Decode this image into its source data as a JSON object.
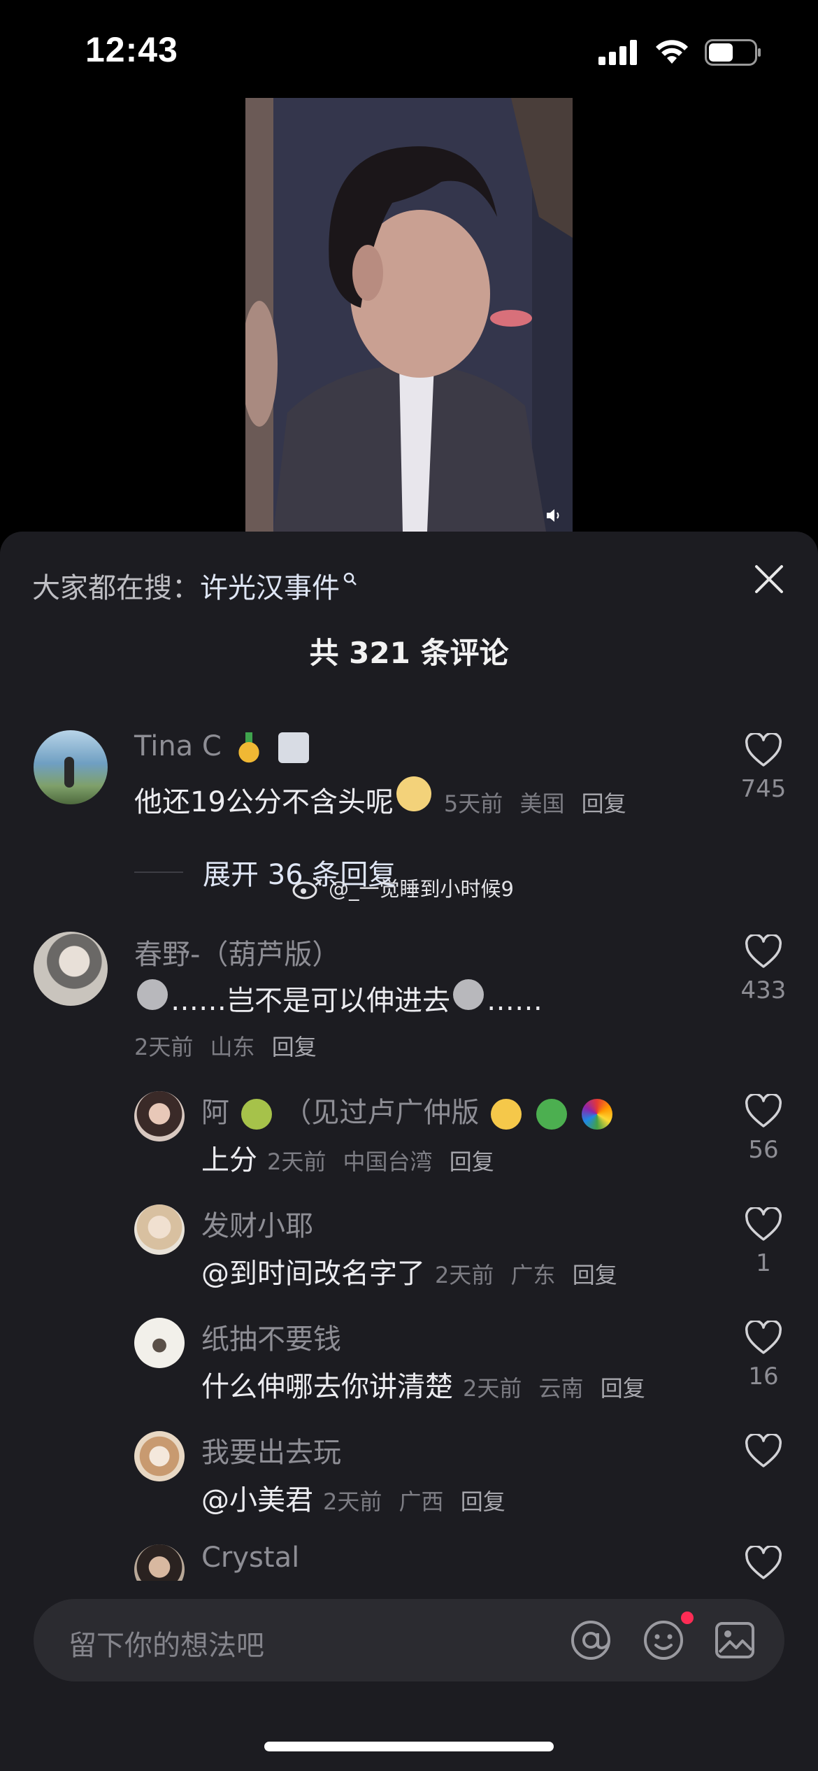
{
  "status_bar": {
    "time": "12:43"
  },
  "sheet": {
    "search_prefix": "大家都在搜：",
    "search_keyword": "许光汉事件",
    "title": "共 321 条评论"
  },
  "comments": [
    {
      "username": "Tina C",
      "text": "他还19公分不含头呢",
      "time": "5天前",
      "location": "美国",
      "reply": "回复",
      "likes": "745"
    },
    {
      "username": "春野-（葫芦版）",
      "text": "……岂不是可以伸进去",
      "text_tail": "……",
      "time": "2天前",
      "location": "山东",
      "reply": "回复",
      "likes": "433"
    }
  ],
  "expand_label": "展开 36 条回复",
  "watermark": "@_一觉睡到小时候9",
  "replies": [
    {
      "username": "阿",
      "username_tail": "（见过卢广仲版",
      "text": "上分",
      "time": "2天前",
      "location": "中国台湾",
      "reply": "回复",
      "likes": "56"
    },
    {
      "username": "发财小耶",
      "text": "@到时间改名字了",
      "time": "2天前",
      "location": "广东",
      "reply": "回复",
      "likes": "1"
    },
    {
      "username": "纸抽不要钱",
      "text": "什么伸哪去你讲清楚",
      "time": "2天前",
      "location": "云南",
      "reply": "回复",
      "likes": "16"
    },
    {
      "username": "我要出去玩",
      "text": "@小美君",
      "time": "2天前",
      "location": "广西",
      "reply": "回复",
      "likes": ""
    },
    {
      "username": "Crystal"
    }
  ],
  "input": {
    "placeholder": "留下你的想法吧"
  },
  "colors": {
    "sheet_bg": "#1c1c21",
    "accent_red": "#fe2c55"
  },
  "icons": [
    "signal-icon",
    "wifi-icon",
    "battery-icon",
    "mute-icon",
    "search-icon",
    "close-icon",
    "heart-icon",
    "at-icon",
    "emoji-icon",
    "image-icon",
    "weibo-icon"
  ]
}
